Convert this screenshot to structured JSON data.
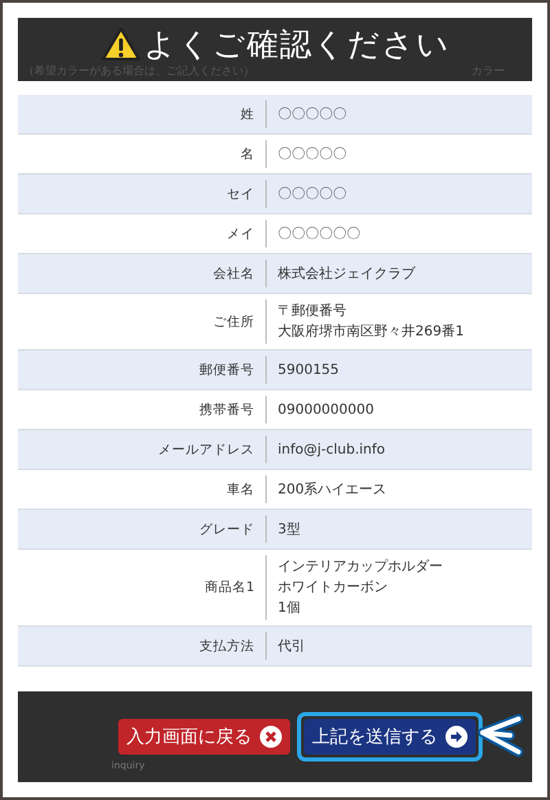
{
  "header": {
    "title": "よくご確認ください",
    "background_note": "（希望カラーがある場合は、ご記入ください）",
    "background_label": "カラー"
  },
  "rows": [
    {
      "label": "姓",
      "value": [
        "〇〇〇〇〇"
      ]
    },
    {
      "label": "名",
      "value": [
        "〇〇〇〇〇"
      ]
    },
    {
      "label": "セイ",
      "value": [
        "〇〇〇〇〇"
      ]
    },
    {
      "label": "メイ",
      "value": [
        "〇〇〇〇〇〇"
      ]
    },
    {
      "label": "会社名",
      "value": [
        "株式会社ジェイクラブ"
      ]
    },
    {
      "label": "ご住所",
      "value": [
        "〒郵便番号",
        "大阪府堺市南区野々井269番1"
      ]
    },
    {
      "label": "郵便番号",
      "value": [
        "5900155"
      ]
    },
    {
      "label": "携帯番号",
      "value": [
        "09000000000"
      ]
    },
    {
      "label": "メールアドレス",
      "value": [
        "info@j-club.info"
      ]
    },
    {
      "label": "車名",
      "value": [
        "200系ハイエース"
      ]
    },
    {
      "label": "グレード",
      "value": [
        "3型"
      ]
    },
    {
      "label": "商品名1",
      "value": [
        "インテリアカップホルダー",
        "ホワイトカーボン",
        "1個"
      ]
    },
    {
      "label": "支払方法",
      "value": [
        "代引"
      ]
    }
  ],
  "footer": {
    "background_text": "inquiry",
    "buttons": [
      {
        "kind": "back",
        "label": "入力画面に戻る",
        "highlighted": false
      },
      {
        "kind": "submit",
        "label": "上記を送信する",
        "highlighted": true
      }
    ]
  }
}
